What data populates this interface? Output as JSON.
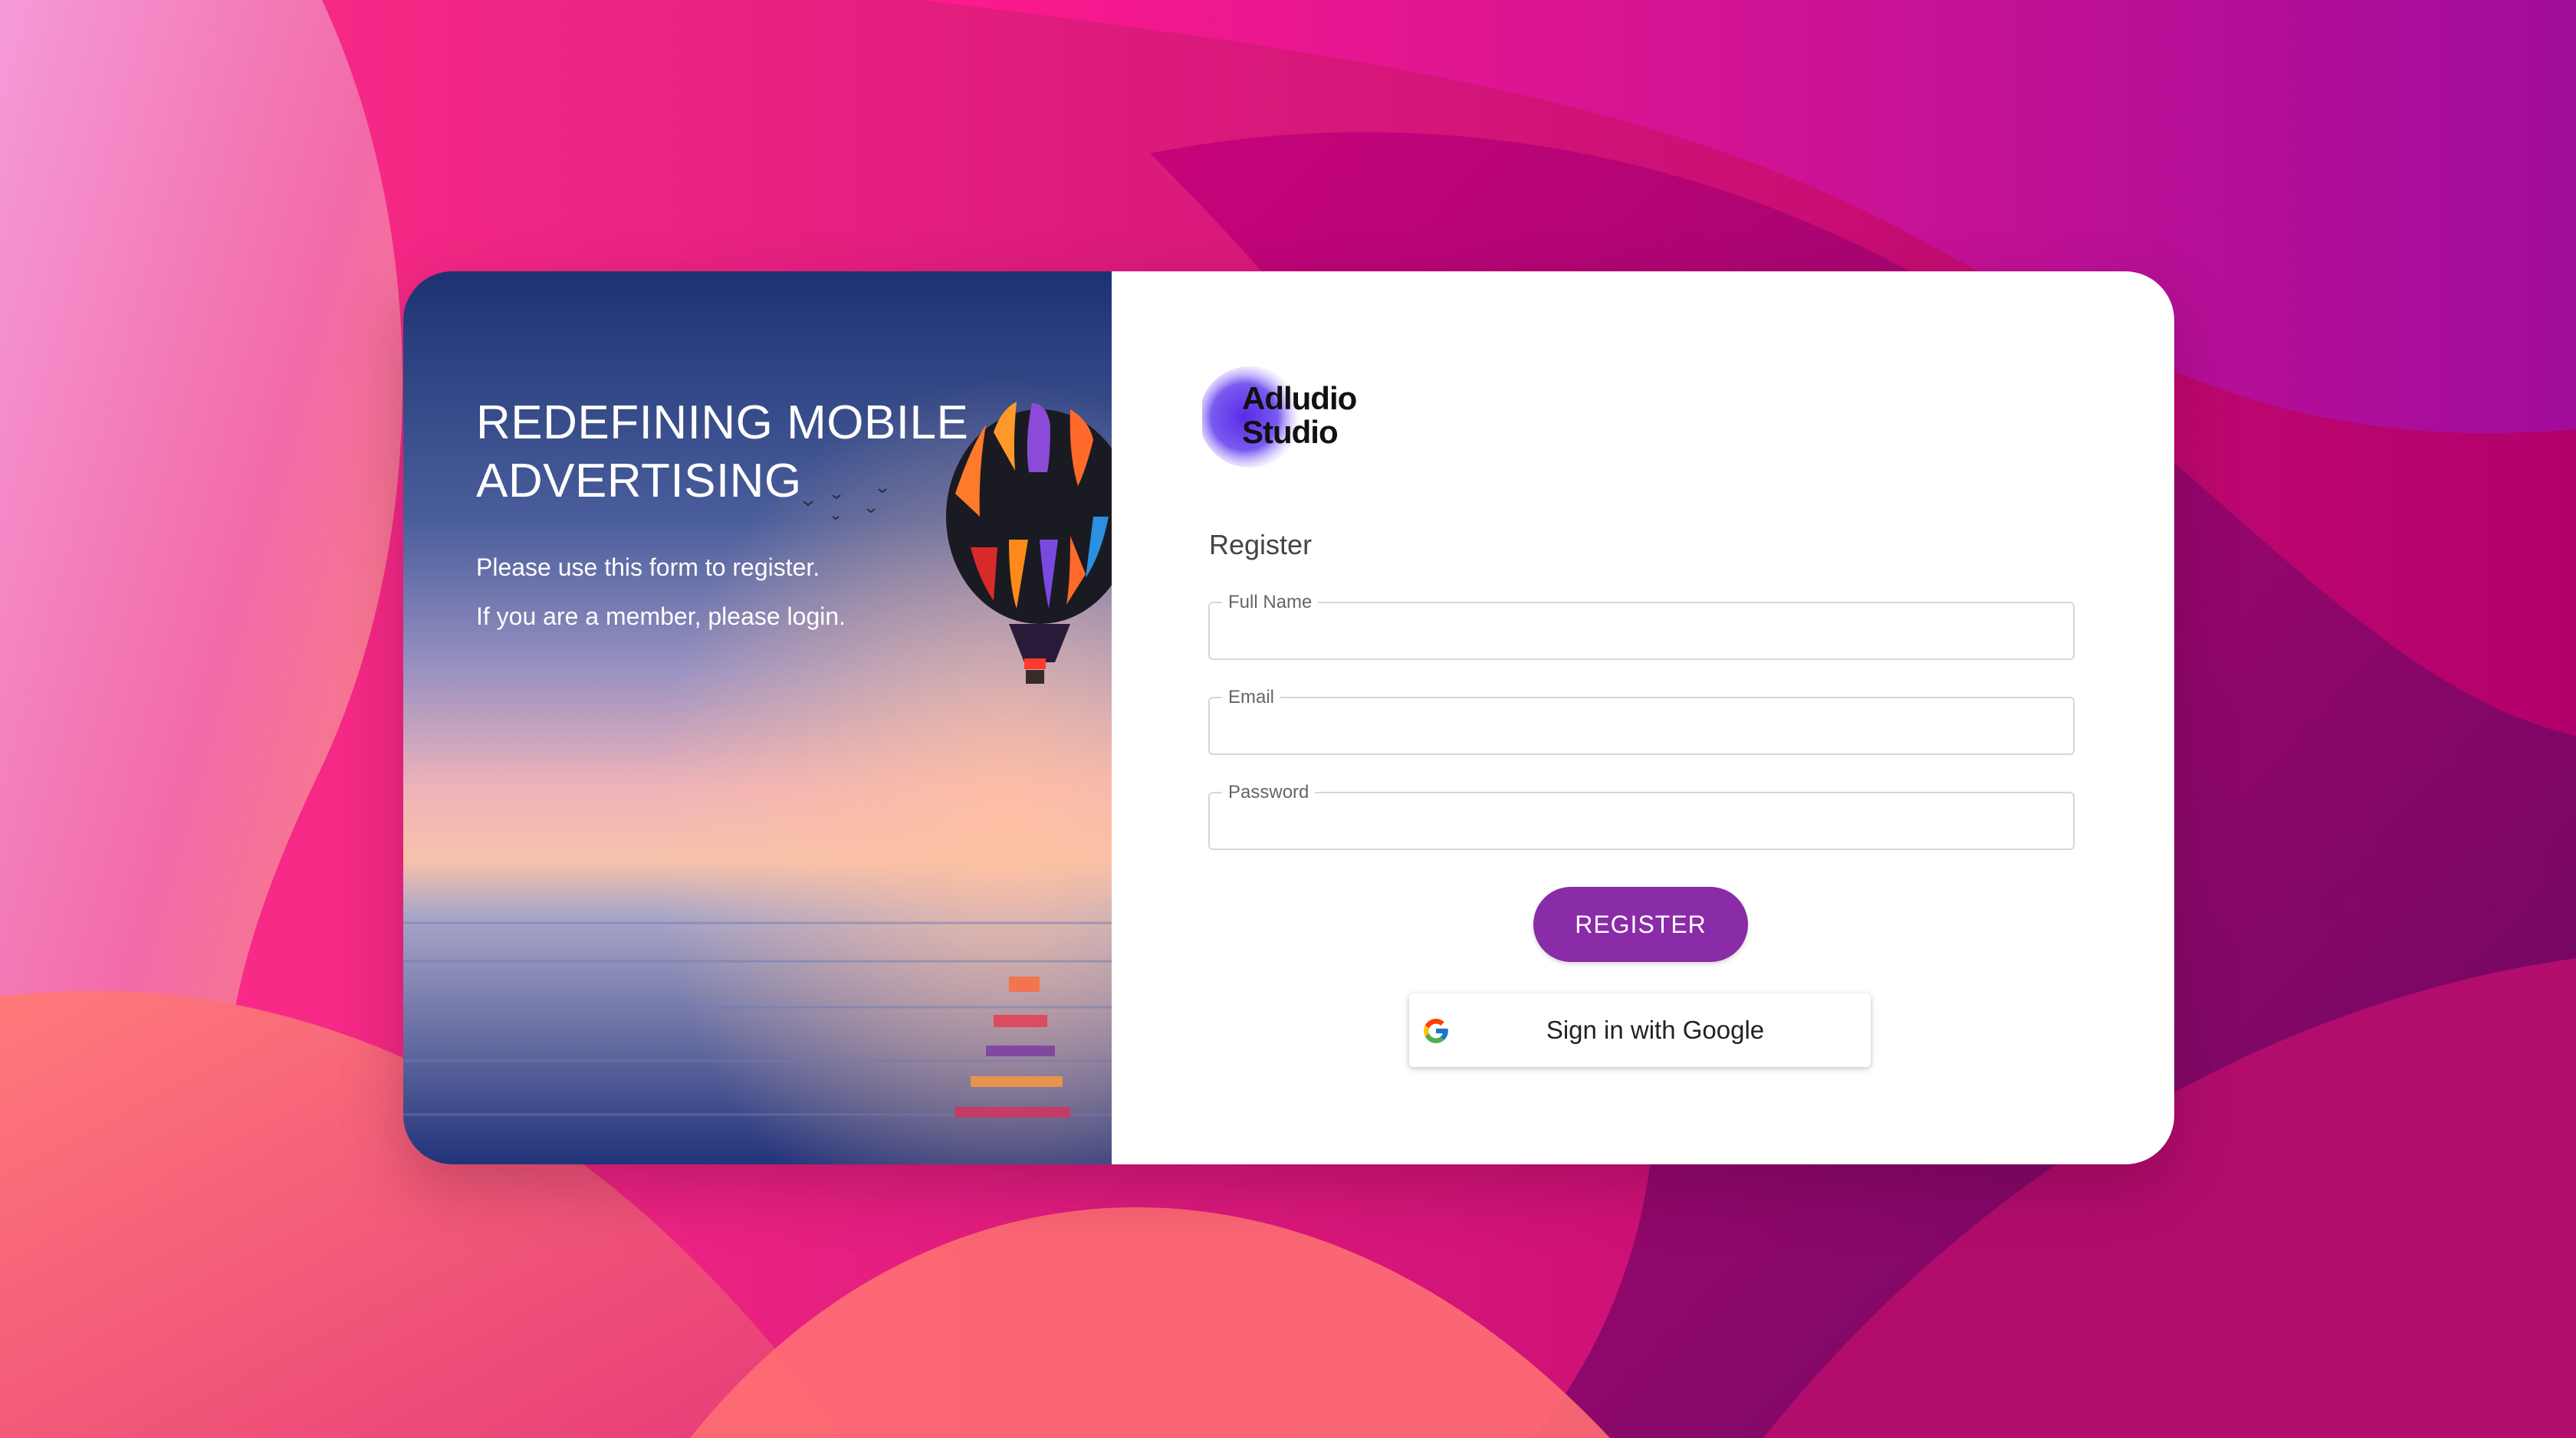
{
  "hero": {
    "title_line1": "REDEFINING MOBILE",
    "title_line2": "ADVERTISING",
    "lines": [
      "Please use this form to register.",
      "If you are a member, please login."
    ]
  },
  "brand": {
    "logo_line1": "Adludio",
    "logo_line2": "Studio",
    "accent": "#8a2ba8"
  },
  "form": {
    "heading": "Register",
    "fields": [
      {
        "label": "Full Name",
        "value": ""
      },
      {
        "label": "Email",
        "value": ""
      },
      {
        "label": "Password",
        "value": ""
      }
    ],
    "register_label": "REGISTER",
    "google_label": "Sign in with Google"
  },
  "icons": {
    "google": "google-icon",
    "balloon": "hot-air-balloon"
  }
}
